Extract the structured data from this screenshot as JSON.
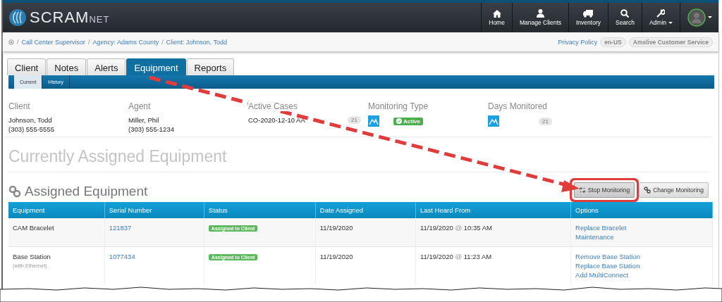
{
  "brand": {
    "name": "SCRAM",
    "suffix": "NET"
  },
  "nav": [
    {
      "label": "Home",
      "kind": "home",
      "has_menu": false
    },
    {
      "label": "Manage Clients",
      "kind": "user",
      "has_menu": false
    },
    {
      "label": "Inventory",
      "kind": "truck",
      "has_menu": false
    },
    {
      "label": "Search",
      "kind": "search",
      "has_menu": false
    },
    {
      "label": "Admin",
      "kind": "wrench",
      "has_menu": true
    }
  ],
  "breadcrumbs": [
    {
      "separator": "/",
      "label": "Call Center Supervisor"
    },
    {
      "separator": "/",
      "label": "Agency: Adams County"
    },
    {
      "separator": "/",
      "label": "Client: Johnson, Todd"
    }
  ],
  "utility": {
    "link": "Privacy Policy",
    "locale": "en-US",
    "service": "Amslive Customer Service"
  },
  "tabs": [
    {
      "label": "Client",
      "selected": false
    },
    {
      "label": "Notes",
      "selected": false
    },
    {
      "label": "Alerts",
      "selected": false
    },
    {
      "label": "Equipment",
      "selected": true
    },
    {
      "label": "Reports",
      "selected": false
    }
  ],
  "subtabs": [
    {
      "label": "Current",
      "selected": true
    },
    {
      "label": "History",
      "selected": false
    }
  ],
  "summary": {
    "client": {
      "label": "Client",
      "name": "Johnson, Todd",
      "phone": "(303) 555-5555"
    },
    "agent": {
      "label": "Agent",
      "name": "Miller, Phil",
      "phone": "(303) 555-1234"
    },
    "cases": {
      "label": "Active Cases",
      "value": "CO-2020-12-10 AA",
      "count": "21"
    },
    "monitoring": {
      "label": "Monitoring Type",
      "status": "Active"
    },
    "days": {
      "label": "Days Monitored",
      "count": "21"
    }
  },
  "page_title": "Currently Assigned Equipment",
  "section_title": "Assigned Equipment",
  "actions": [
    {
      "label": "Stop Monitoring",
      "kind": "unlink",
      "highlighted": true
    },
    {
      "label": "Change Monitoring",
      "kind": "link",
      "highlighted": false
    }
  ],
  "table": {
    "columns": [
      "Equipment",
      "Serial Number",
      "Status",
      "Date Assigned",
      "Last Heard From",
      "Options"
    ],
    "rows": [
      {
        "equipment": "CAM Bracelet",
        "serial": "121837",
        "status": "Assigned to Client",
        "date": "11/19/2020",
        "last_heard": "11/19/2020",
        "at": "@",
        "time": "10:35 AM",
        "options": [
          "Replace Bracelet",
          "Maintenance"
        ]
      },
      {
        "equipment": "Base Station",
        "note": "(with Ethernet)",
        "serial": "1077434",
        "status": "Assigned to Client",
        "date": "11/19/2020",
        "last_heard": "11/19/2020",
        "at": "@",
        "time": "11:23 AM",
        "options": [
          "Remove Base Station",
          "Replace Base Station",
          "Add MultiConnect"
        ]
      }
    ]
  }
}
